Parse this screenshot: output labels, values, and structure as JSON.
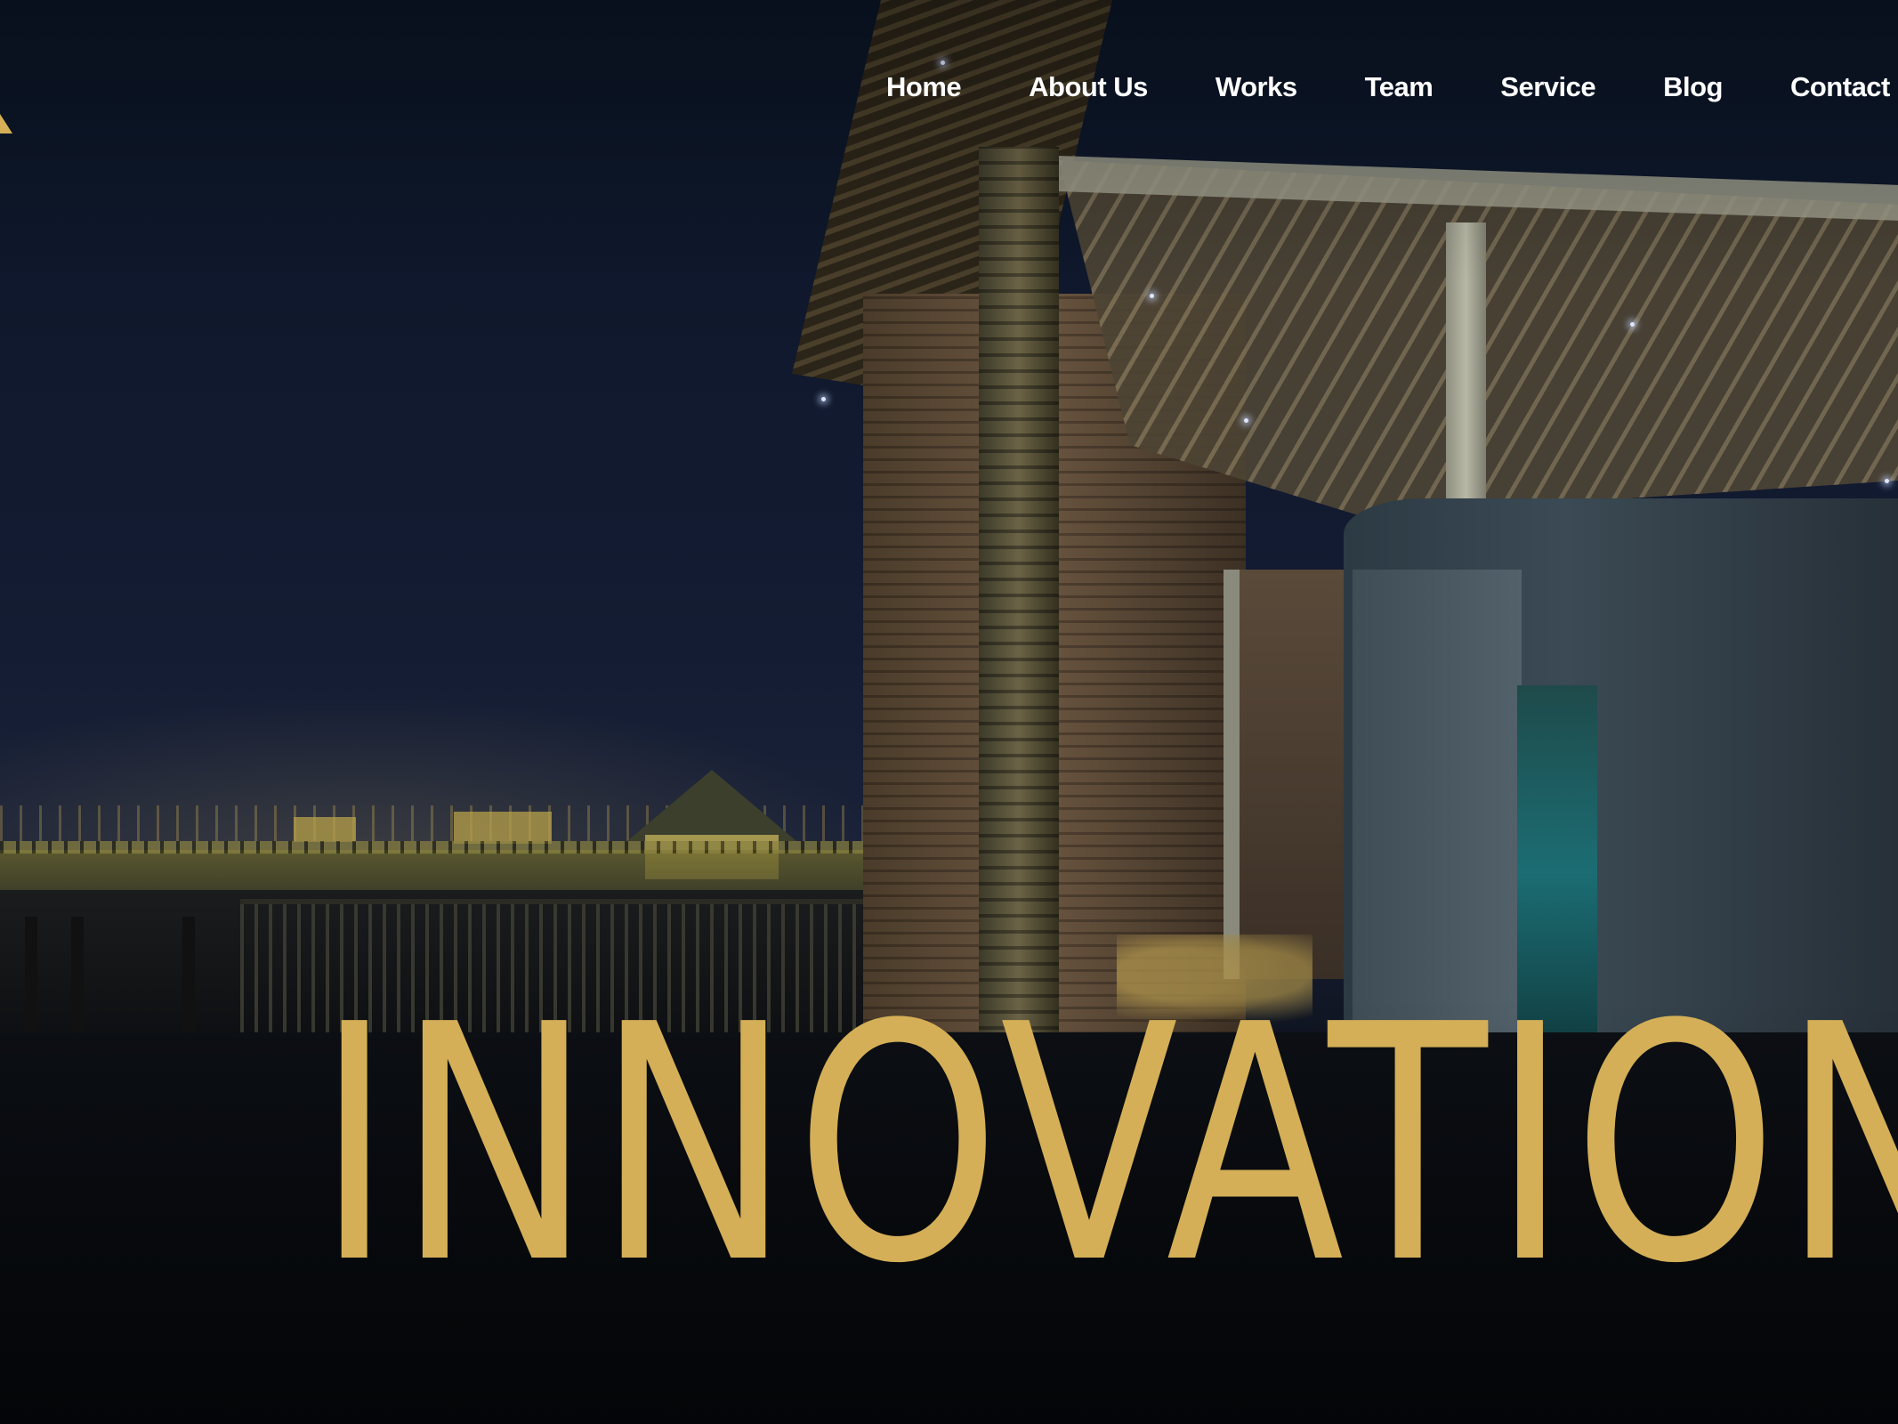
{
  "logo": {
    "icon": "triangle-logo-icon",
    "color": "#d4af57"
  },
  "nav": {
    "items": [
      {
        "label": "Home"
      },
      {
        "label": "About Us"
      },
      {
        "label": "Works"
      },
      {
        "label": "Team"
      },
      {
        "label": "Service"
      },
      {
        "label": "Blog"
      },
      {
        "label": "Contact"
      }
    ],
    "text_color": "#ffffff"
  },
  "hero": {
    "headline": "INNOVATION",
    "headline_color": "#d4af57",
    "background": "night-photo-waterfront-building"
  }
}
